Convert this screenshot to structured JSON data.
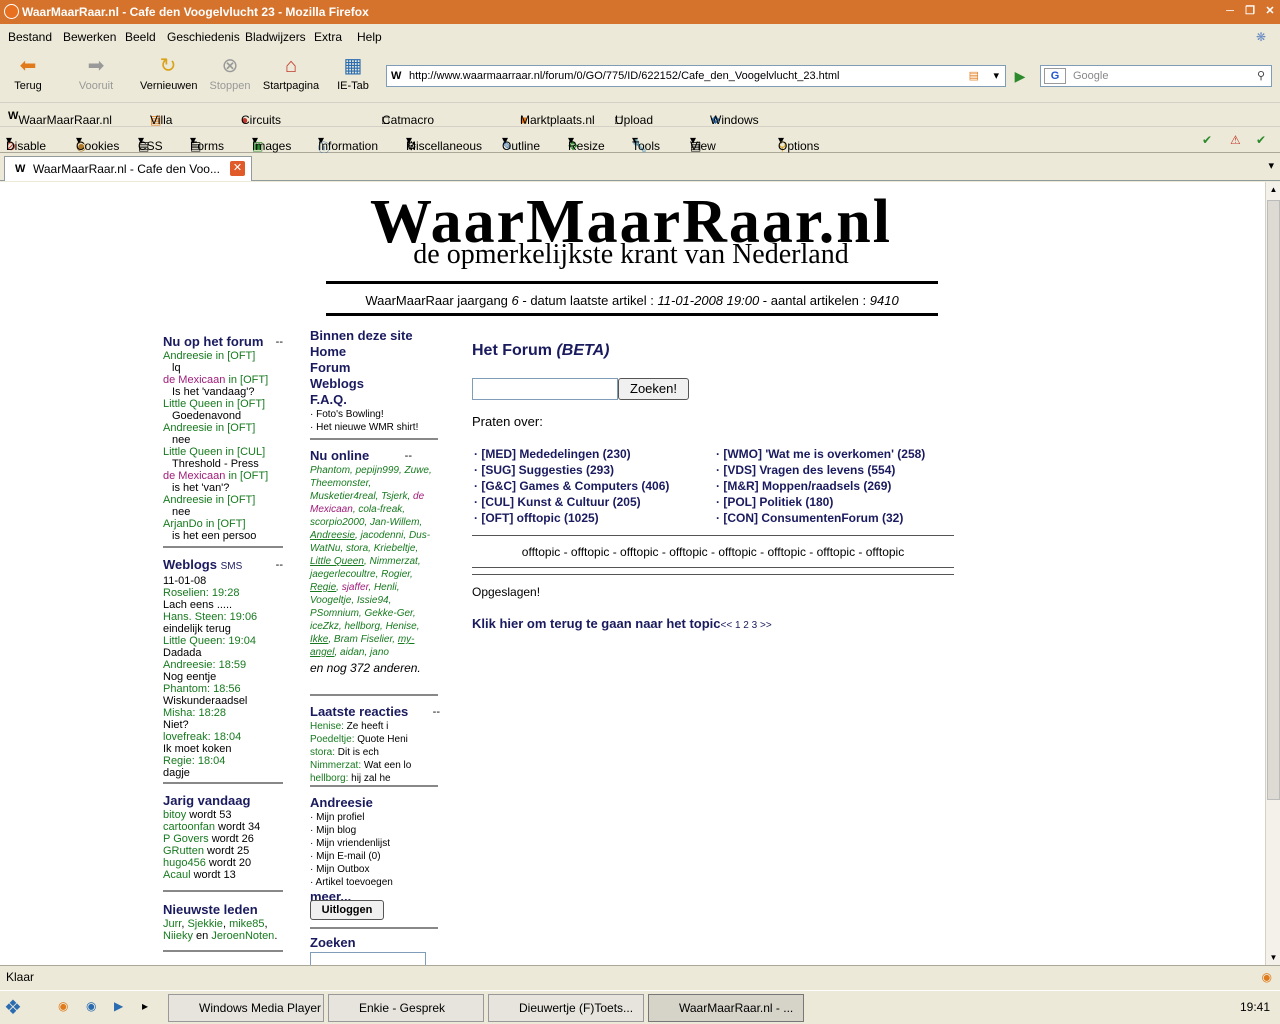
{
  "window": {
    "title": "WaarMaarRaar.nl - Cafe den Voogelvlucht 23 - Mozilla Firefox"
  },
  "menu": [
    "Bestand",
    "Bewerken",
    "Beeld",
    "Geschiedenis",
    "Bladwijzers",
    "Extra",
    "Help"
  ],
  "nav": {
    "back": "Terug",
    "forward": "Vooruit",
    "reload": "Vernieuwen",
    "stop": "Stoppen",
    "home": "Startpagina",
    "ietab": "IE-Tab"
  },
  "url": "http://www.waarmaarraar.nl/forum/0/GO/775/ID/622152/Cafe_den_Voogelvlucht_23.html",
  "search_placeholder": "Google",
  "bookmarks": [
    "WaarMaarRaar.nl - d...",
    "Villa FiloSofia",
    "Circuits Online - Foru...",
    "Catmacro Weebls-stuff",
    "Marktplaats.nl",
    "Upload Archief",
    "Windows Live Hotmail"
  ],
  "devbar": [
    "Disable",
    "Cookies",
    "CSS",
    "Forms",
    "Images",
    "Information",
    "Miscellaneous",
    "Outline",
    "Resize",
    "Tools",
    "View Source",
    "Options"
  ],
  "tab": "WaarMaarRaar.nl - Cafe den Voo...",
  "status": "Klaar",
  "taskbar": [
    "Windows Media Player",
    "Enkie - Gesprek",
    "Dieuwertje (F)Toets...",
    "WaarMaarRaar.nl - ..."
  ],
  "clock": "19:41",
  "site": {
    "logo": "WaarMaarRaar.nl",
    "tagline": "de opmerkelijkste krant van Nederland",
    "info_prefix": "WaarMaarRaar jaargang ",
    "info_year": "6",
    "info_mid": " - datum laatste artikel : ",
    "info_date": "11-01-2008 19:00",
    "info_mid2": " - aantal artikelen : ",
    "info_count": "9410"
  },
  "forum_now": {
    "title": "Nu op het forum",
    "toggle": "--",
    "items": [
      {
        "user": "Andreesie",
        "in": "in [OFT]",
        "msg": "lq",
        "cls": "g"
      },
      {
        "user": "de Mexicaan",
        "in": "in [OFT]",
        "msg": "Is het 'vandaag'?",
        "cls": "p"
      },
      {
        "user": "Little Queen",
        "in": "in [OFT]",
        "msg": "Goedenavond",
        "cls": "g"
      },
      {
        "user": "Andreesie",
        "in": "in [OFT]",
        "msg": "nee",
        "cls": "g"
      },
      {
        "user": "Little Queen",
        "in": "in [CUL]",
        "msg": "Threshold - Press",
        "cls": "g"
      },
      {
        "user": "de Mexicaan",
        "in": "in [OFT]",
        "msg": "is het 'van'?",
        "cls": "p"
      },
      {
        "user": "Andreesie",
        "in": "in [OFT]",
        "msg": "nee",
        "cls": "g"
      },
      {
        "user": "ArjanDo",
        "in": "in [OFT]",
        "msg": "is het een persoo",
        "cls": "g"
      }
    ]
  },
  "weblogs": {
    "title": "Weblogs",
    "sub": "SMS",
    "toggle": "--",
    "date": "11-01-08",
    "items": [
      {
        "who": "Roselien: 19:28",
        "msg": "Lach eens ....."
      },
      {
        "who": "Hans. Steen: 19:06",
        "msg": "eindelijk terug"
      },
      {
        "who": "Little Queen: 19:04",
        "msg": "Dadada"
      },
      {
        "who": "Andreesie: 18:59",
        "msg": "Nog eentje"
      },
      {
        "who": "Phantom: 18:56",
        "msg": "Wiskunderaadsel"
      },
      {
        "who": "Misha: 18:28",
        "msg": "Niet?"
      },
      {
        "who": "lovefreak: 18:04",
        "msg": "Ik moet koken"
      },
      {
        "who": "Regie: 18:04",
        "msg": "dagje"
      }
    ]
  },
  "jarig": {
    "title": "Jarig vandaag",
    "items": [
      {
        "name": "bitoy",
        "txt": " wordt 53"
      },
      {
        "name": "cartoonfan",
        "txt": " wordt 34"
      },
      {
        "name": "P Govers",
        "txt": " wordt 26"
      },
      {
        "name": "GRutten",
        "txt": " wordt 25"
      },
      {
        "name": "hugo456",
        "txt": " wordt 20"
      },
      {
        "name": "Acaul",
        "txt": " wordt 13"
      }
    ]
  },
  "nieuwste": {
    "title": "Nieuwste leden",
    "l1a": "Jurr",
    "l1b": "Sjekkie",
    "l1c": "mike85",
    "l2a": "Niieky",
    "en": " en ",
    "l2b": "JeroenNoten"
  },
  "binnen": {
    "title": "Binnen deze site",
    "links": [
      "Home",
      "Forum",
      "Weblogs",
      "F.A.Q."
    ],
    "small": [
      "· Foto's Bowling!",
      "· Het nieuwe WMR shirt!"
    ]
  },
  "online": {
    "title": "Nu online",
    "toggle": "--",
    "names": "Phantom, pepijn999, Zuwe, Theemonster, Musketier4real, Tsjerk,",
    "mex": "de Mexicaan",
    "names2": ", cola-freak, scorpio2000, Jan-Willem,",
    "and": "Andreesie",
    "names3": ", jacodenni, Dus-WatNu, stora, Kriebeltje,",
    "lq": "Little Queen",
    "names4": ", Nimmerzat, jaegerlecoultre, Rogier,",
    "regie": "Regie",
    "names5": ", ",
    "sjaffer": "sjaffer",
    "names6": ", Henli, Voogeltje, Issie94, PSomnium, Gekke-Ger, iceZkz, hellborg, Henise,",
    "ikke": "Ikke",
    "names7": ", Bram Fiselier,",
    "myangel": "my-angel",
    "names8": ", aidan, jano",
    "rest": "en nog 372 anderen."
  },
  "reacties": {
    "title": "Laatste reacties",
    "toggle": "--",
    "items": [
      {
        "u": "Henise:",
        "m": " Ze heeft i"
      },
      {
        "u": "Poedeltje:",
        "m": " Quote Heni"
      },
      {
        "u": "stora:",
        "m": " Dit is ech"
      },
      {
        "u": "Nimmerzat:",
        "m": " Wat een lo"
      },
      {
        "u": "hellborg:",
        "m": " hij zal he"
      }
    ]
  },
  "user": {
    "title": "Andreesie",
    "links": [
      "· Mijn profiel",
      "· Mijn blog",
      "· Mijn vriendenlijst",
      "· Mijn E-mail (0)",
      "· Mijn Outbox",
      "· Artikel toevoegen"
    ],
    "meer": "meer...",
    "logout": "Uitloggen"
  },
  "zoeken": {
    "title": "Zoeken"
  },
  "forum": {
    "title": "Het Forum ",
    "beta": "(BETA)",
    "search_btn": "Zoeken!",
    "praten": "Praten over:",
    "left": [
      "· [MED] Mededelingen (230)",
      "· [SUG] Suggesties (293)",
      "· [G&C] Games & Computers (406)",
      "· [CUL] Kunst & Cultuur (205)",
      "· [OFT] offtopic (1025)"
    ],
    "right": [
      "· [WMO] 'Wat me is overkomen' (258)",
      "· [VDS] Vragen des levens (554)",
      "· [M&R] Moppen/raadsels (269)",
      "· [POL] Politiek (180)",
      "· [CON] ConsumentenForum (32)"
    ],
    "offtopic": "offtopic - offtopic - offtopic - offtopic - offtopic - offtopic - offtopic - offtopic",
    "saved": "Opgeslagen!",
    "back": "Klik hier om terug te gaan naar het topic",
    "pages": "<< 1 2 3 >>"
  }
}
